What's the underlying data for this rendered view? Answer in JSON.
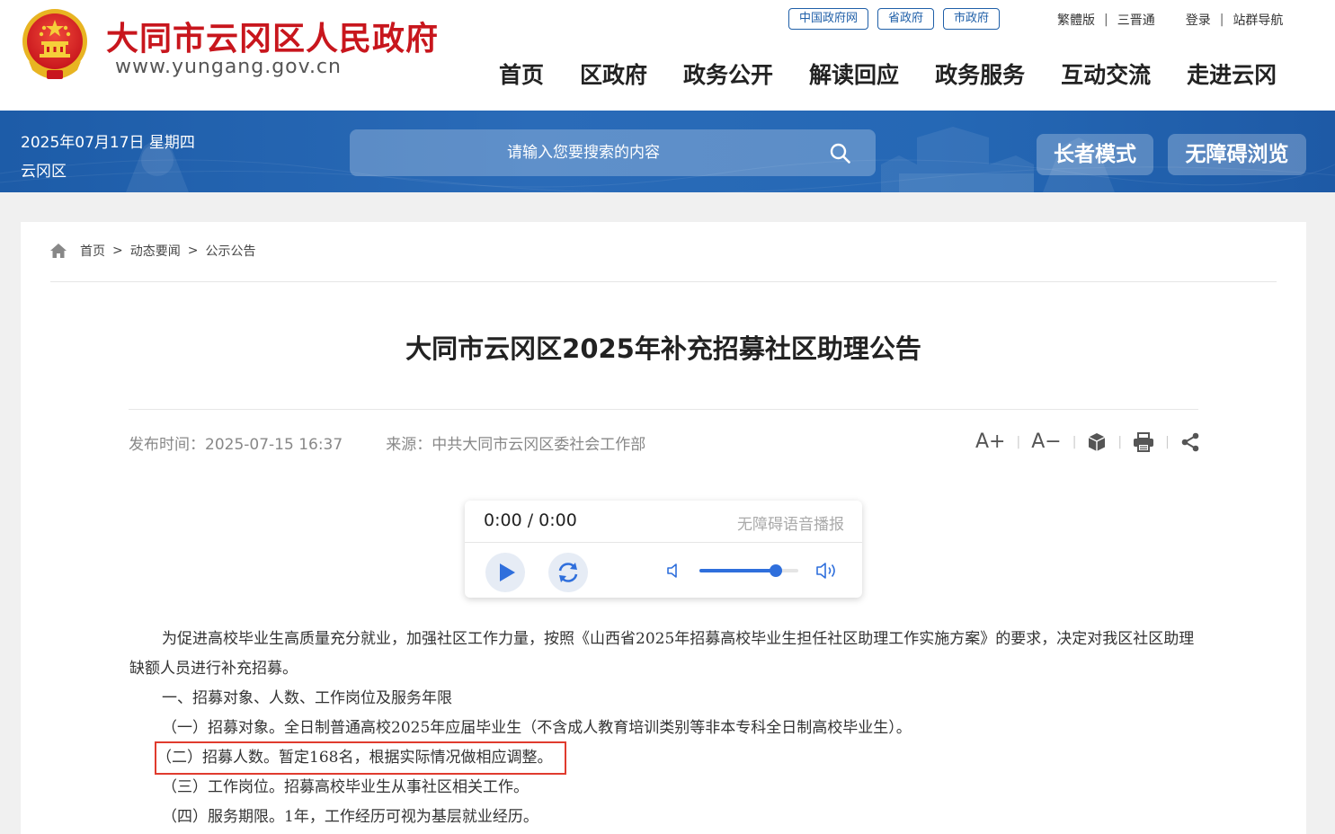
{
  "header": {
    "site_name": "大同市云冈区人民政府",
    "site_url": "www.yungang.gov.cn",
    "top_links": [
      "中国政府网",
      "省政府",
      "市政府"
    ],
    "util_links": {
      "traditional": "繁體版",
      "sanjin": "三晋通",
      "login": "登录",
      "site_nav": "站群导航",
      "sep": "|"
    },
    "nav": [
      "首页",
      "区政府",
      "政务公开",
      "解读回应",
      "政务服务",
      "互动交流",
      "走进云冈"
    ]
  },
  "bluebar": {
    "date": "2025年07月17日 星期四",
    "district": "云冈区",
    "search_placeholder": "请输入您要搜索的内容",
    "elder_mode": "长者模式",
    "accessible": "无障碍浏览"
  },
  "breadcrumb": {
    "items": [
      "首页",
      "动态要闻",
      "公示公告"
    ],
    "sep": ">"
  },
  "article": {
    "title": "大同市云冈区2025年补充招募社区助理公告",
    "publish_time": "发布时间：2025-07-15 16:37",
    "source": "来源：中共大同市云冈区委社会工作部",
    "tools": {
      "font_up": "A+",
      "font_down": "A−",
      "sep": "|"
    },
    "paragraphs": [
      "为促进高校毕业生高质量充分就业，加强社区工作力量，按照《山西省2025年招募高校毕业生担任社区助理工作实施方案》的要求，决定对我区社区助理缺额人员进行补充招募。",
      "一、招募对象、人数、工作岗位及服务年限",
      "（一）招募对象。全日制普通高校2025年应届毕业生（不含成人教育培训类别等非本专科全日制高校毕业生）。",
      "（二）招募人数。暂定168名，根据实际情况做相应调整。",
      "（三）工作岗位。招募高校毕业生从事社区相关工作。",
      "（四）服务期限。1年，工作经历可视为基层就业经历。"
    ]
  },
  "player": {
    "time": "0:00 / 0:00",
    "label": "无障碍语音播报",
    "volume_percent": 77,
    "colors": {
      "accent": "#2f6fdc"
    }
  },
  "colors": {
    "brand_red": "#c8161d",
    "nav_blue": "#1f5fa8",
    "highlight_border": "#e03b2e"
  }
}
